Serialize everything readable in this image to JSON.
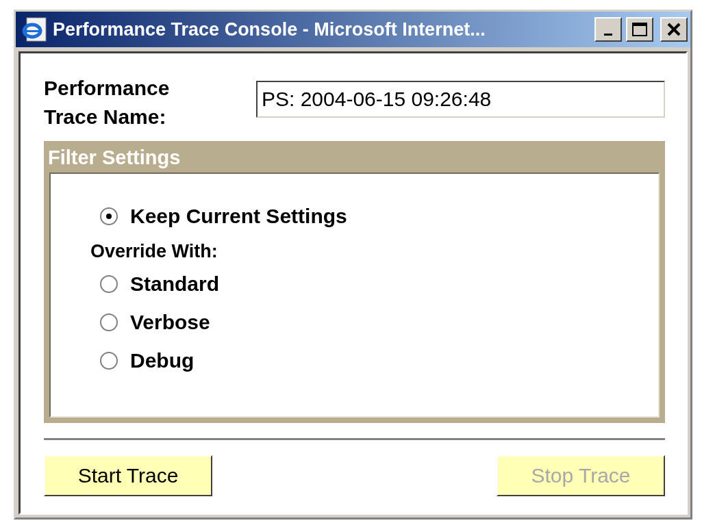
{
  "window": {
    "title": "Performance Trace Console - Microsoft Internet..."
  },
  "trace_name": {
    "label": "Performance Trace Name:",
    "value": "PS: 2004-06-15 09:26:48"
  },
  "filter_settings": {
    "title": "Filter Settings",
    "keep_option": {
      "label": "Keep Current Settings",
      "selected": true
    },
    "override_label": "Override With:",
    "override_options": [
      {
        "label": "Standard",
        "selected": false
      },
      {
        "label": "Verbose",
        "selected": false
      },
      {
        "label": "Debug",
        "selected": false
      }
    ]
  },
  "buttons": [
    {
      "label": "Start Trace",
      "disabled": false
    },
    {
      "label": "Stop Trace",
      "disabled": true
    }
  ]
}
